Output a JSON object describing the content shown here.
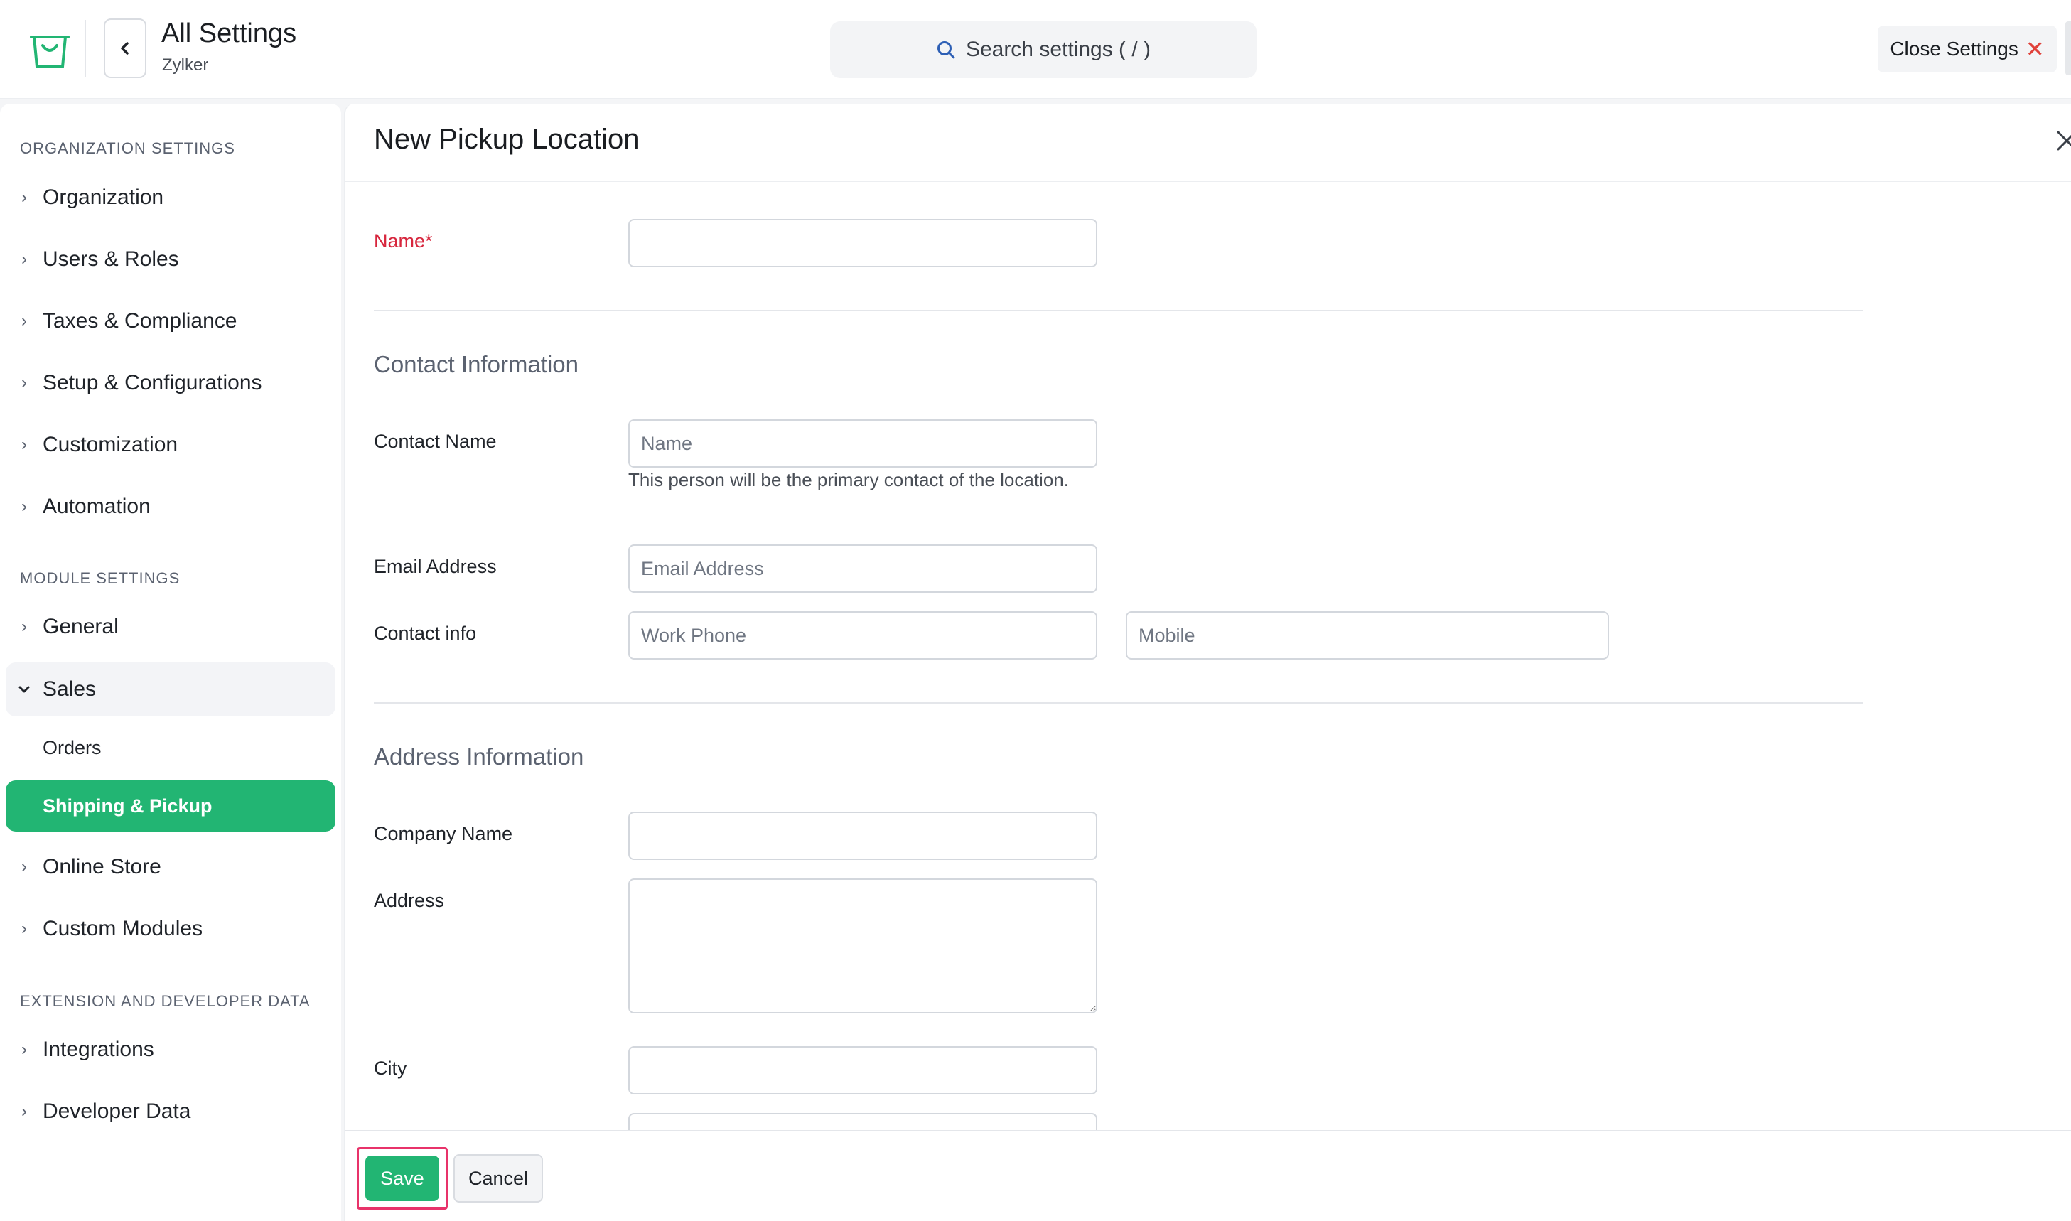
{
  "header": {
    "title": "All Settings",
    "subtitle": "Zylker",
    "search_placeholder": "Search settings ( / )",
    "close_label": "Close Settings"
  },
  "sidebar": {
    "sections": [
      {
        "label": "ORGANIZATION SETTINGS"
      },
      {
        "label": "MODULE SETTINGS"
      },
      {
        "label": "EXTENSION AND DEVELOPER DATA"
      }
    ],
    "items": [
      {
        "label": "Organization"
      },
      {
        "label": "Users & Roles"
      },
      {
        "label": "Taxes & Compliance"
      },
      {
        "label": "Setup & Configurations"
      },
      {
        "label": "Customization"
      },
      {
        "label": "Automation"
      },
      {
        "label": "General"
      },
      {
        "label": "Sales"
      },
      {
        "label": "Online Store"
      },
      {
        "label": "Custom Modules"
      },
      {
        "label": "Integrations"
      },
      {
        "label": "Developer Data"
      }
    ],
    "sub_items": [
      {
        "label": "Orders"
      },
      {
        "label": "Shipping & Pickup"
      }
    ]
  },
  "panel": {
    "title": "New Pickup Location",
    "name_label": "Name*",
    "contact_section": "Contact Information",
    "contact_name_label": "Contact Name",
    "contact_name_placeholder": "Name",
    "contact_helper": "This person will be the primary contact of the location.",
    "email_label": "Email Address",
    "email_placeholder": "Email Address",
    "contact_info_label": "Contact info",
    "work_phone_placeholder": "Work Phone",
    "mobile_placeholder": "Mobile",
    "address_section": "Address Information",
    "company_label": "Company Name",
    "address_label": "Address",
    "city_label": "City"
  },
  "footer": {
    "save_label": "Save",
    "cancel_label": "Cancel"
  },
  "colors": {
    "accent": "#22b573",
    "required": "#d7263d",
    "highlight": "#e8336a"
  }
}
